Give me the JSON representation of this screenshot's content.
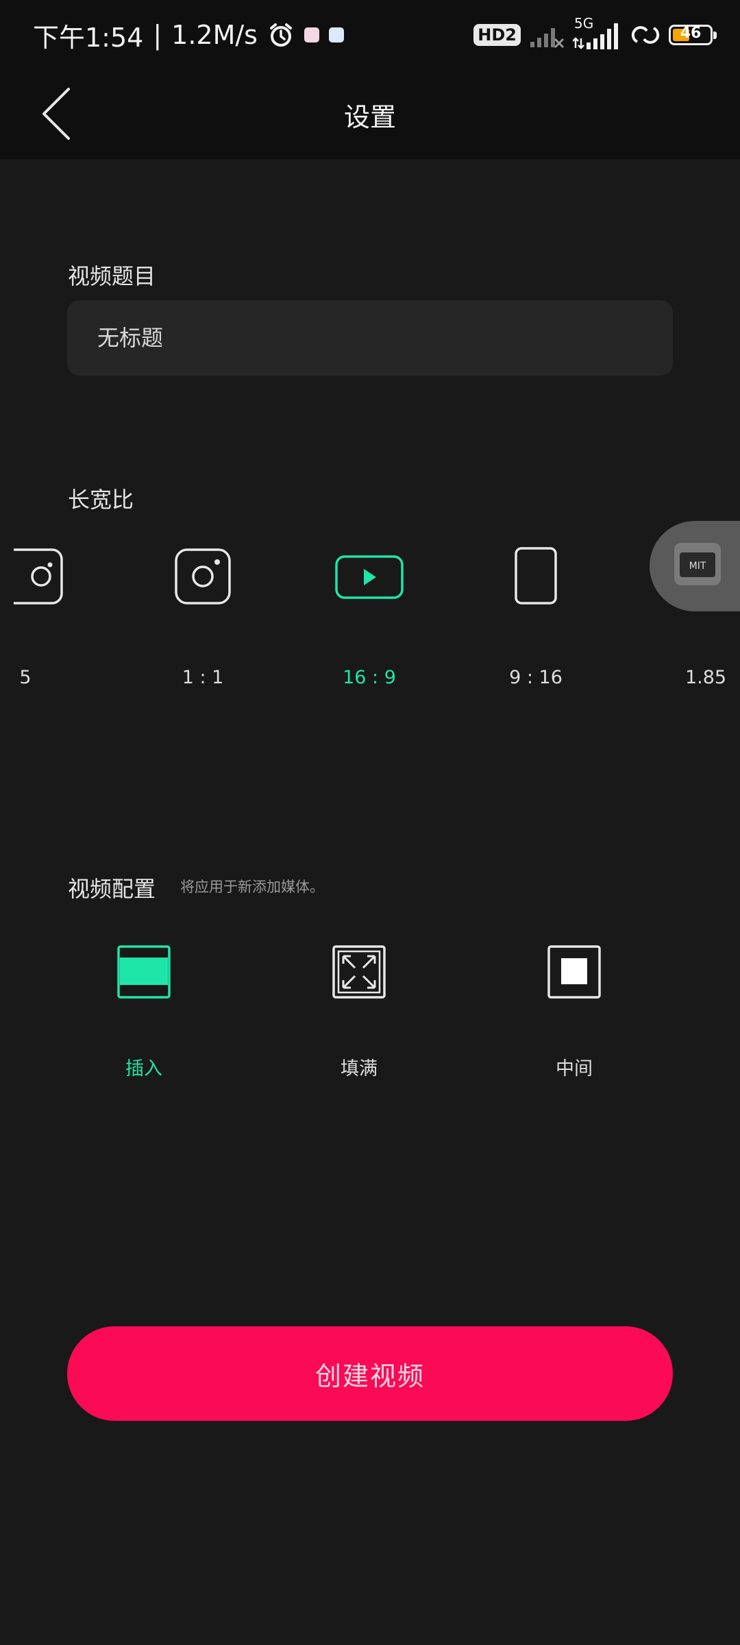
{
  "status_bar": {
    "time": "下午1:54",
    "separator": "|",
    "net_speed": "1.2M/s",
    "hd_badge": "HD2",
    "network": "5G",
    "battery": "46",
    "battery_color": "#f6a400"
  },
  "header": {
    "title": "设置",
    "back_icon": "chevron-left-icon"
  },
  "title_section": {
    "label": "视频题目",
    "input_value": "",
    "placeholder": "无标题"
  },
  "aspect_section": {
    "label": "长宽比",
    "options": [
      {
        "label": "5",
        "icon": "portrait-camera-icon",
        "selected": false
      },
      {
        "label": "1 : 1",
        "icon": "instagram-icon",
        "selected": false
      },
      {
        "label": "16 : 9",
        "icon": "youtube-play-icon",
        "selected": true
      },
      {
        "label": "9 : 16",
        "icon": "phone-portrait-icon",
        "selected": false
      },
      {
        "label": "1.85",
        "icon": "film-icon",
        "selected": false
      }
    ]
  },
  "config_section": {
    "label": "视频配置",
    "subtitle": "将应用于新添加媒体。",
    "options": [
      {
        "label": "插入",
        "icon": "fit-inside-icon",
        "selected": true
      },
      {
        "label": "填满",
        "icon": "expand-fill-icon",
        "selected": false
      },
      {
        "label": "中间",
        "icon": "center-square-icon",
        "selected": false
      }
    ]
  },
  "floating_bubble": {
    "text": "MIT"
  },
  "create_button": {
    "label": "创建视频"
  },
  "colors": {
    "accent": "#1ee6a8",
    "primary_button": "#fb0a56",
    "background": "#191919"
  }
}
